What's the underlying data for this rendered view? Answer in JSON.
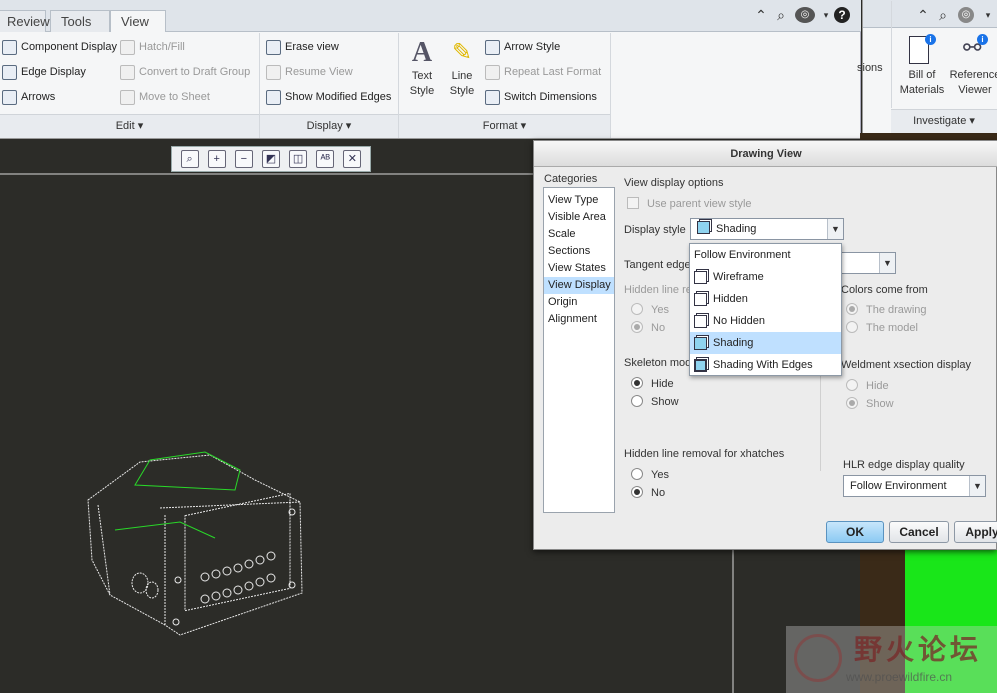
{
  "tabs": [
    "Review",
    "Tools",
    "View"
  ],
  "ribbon": {
    "edit": {
      "items": [
        {
          "label": "Component Display",
          "enabled": true
        },
        {
          "label": "Edge Display",
          "enabled": true
        },
        {
          "label": "Arrows",
          "enabled": true
        }
      ],
      "items2": [
        {
          "label": "Hatch/Fill",
          "enabled": false
        },
        {
          "label": "Convert to Draft Group",
          "enabled": false
        },
        {
          "label": "Move to Sheet",
          "enabled": false
        }
      ],
      "footer": "Edit ▾"
    },
    "display": {
      "items": [
        {
          "label": "Erase view",
          "enabled": true
        },
        {
          "label": "Resume View",
          "enabled": false
        },
        {
          "label": "Show Modified Edges",
          "enabled": true
        }
      ],
      "footer": "Display ▾"
    },
    "format": {
      "text_style": "Text\nStyle",
      "line_style": "Line\nStyle",
      "items": [
        {
          "label": "Arrow Style",
          "enabled": true
        },
        {
          "label": "Repeat Last Format",
          "enabled": false
        },
        {
          "label": "Switch Dimensions",
          "enabled": true
        }
      ],
      "footer": "Format ▾"
    },
    "investigate": {
      "partial": "sions",
      "bom": "Bill of\nMaterials",
      "ref": "Reference\nViewer",
      "footer": "Investigate ▾"
    }
  },
  "dialog": {
    "title": "Drawing View",
    "categories_label": "Categories",
    "categories": [
      "View Type",
      "Visible Area",
      "Scale",
      "Sections",
      "View States",
      "View Display",
      "Origin",
      "Alignment"
    ],
    "selected_category": "View Display",
    "view_display_options": "View display options",
    "use_parent": "Use parent view style",
    "display_style_label": "Display style",
    "display_style_value": "Shading",
    "dropdown": [
      "Follow Environment",
      "Wireframe",
      "Hidden",
      "No Hidden",
      "Shading",
      "Shading With Edges"
    ],
    "dropdown_highlight": "Shading",
    "tangent_label": "Tangent edge",
    "hidden_line_label": "Hidden line re",
    "yes": "Yes",
    "no": "No",
    "skeleton_label": "Skeleton mod",
    "hide": "Hide",
    "show": "Show",
    "hidden_xhatch_label": "Hidden line removal for xhatches",
    "colors_label": "Colors come from",
    "the_drawing": "The drawing",
    "the_model": "The model",
    "weldment_label": "Weldment xsection display",
    "hlr_label": "HLR edge display quality",
    "hlr_value": "Follow Environment",
    "ok": "OK",
    "cancel": "Cancel",
    "apply": "Apply"
  },
  "watermark": {
    "cn": "野火论坛",
    "url": "www.proewildfire.cn"
  }
}
